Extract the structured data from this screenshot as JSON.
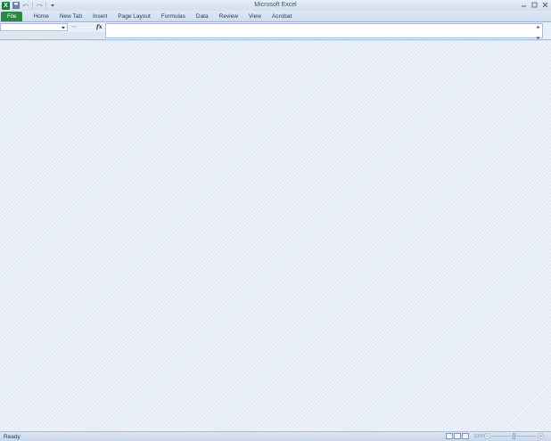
{
  "window": {
    "title": "Microsoft Excel",
    "app_logo_letter": "X"
  },
  "ribbon": {
    "file_label": "File",
    "tabs": [
      "Home",
      "New Tab",
      "Insert",
      "Page Layout",
      "Formulas",
      "Data",
      "Review",
      "View",
      "Acrobat"
    ],
    "help_label": "?"
  },
  "formula_bar": {
    "fx_label": "fx"
  },
  "status": {
    "text": "Ready",
    "zoom": "100%"
  },
  "colors": {
    "file_tab": "#2a8a3e",
    "workspace": "#e4ebf4"
  }
}
